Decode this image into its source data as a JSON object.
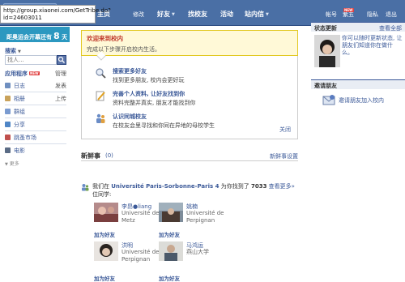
{
  "tooltip": {
    "line1": "http://group.xiaonei.com/GetTribe.do?",
    "line2": "id=24603011"
  },
  "nav": {
    "home": "主页",
    "edit": "修改",
    "friends": "好友",
    "find_friends": "找校友",
    "events": "活动",
    "inbox": "站内信",
    "account": "帐号",
    "homepage": "紫五",
    "new_badge": "NEW",
    "privacy": "隐私",
    "logout": "退出"
  },
  "countdown": {
    "text": "距奥运会开幕还有",
    "days": "8",
    "unit": "天"
  },
  "sidebar": {
    "search_title": "搜索",
    "search_placeholder": "找人...",
    "apps_title": "应用程序",
    "apps_new": "NEW",
    "apps_manage": "管理",
    "items": [
      {
        "label": "日志",
        "action": "发表",
        "color": "#6f8fc0"
      },
      {
        "label": "相册",
        "action": "上传",
        "color": "#c9a25a"
      },
      {
        "label": "群组",
        "action": "",
        "color": "#7a9bd0"
      },
      {
        "label": "分享",
        "action": "",
        "color": "#4f86c6"
      },
      {
        "label": "跳蚤市场",
        "action": "",
        "color": "#c0504d"
      },
      {
        "label": "电影",
        "action": "",
        "color": "#5a6b85"
      }
    ],
    "more": "更多"
  },
  "welcome": {
    "title": "欢迎来到校内",
    "subtitle": "完成以下步骤开启校内生活。"
  },
  "tips": [
    {
      "title": "搜索更多好友",
      "desc": "找到更多朋友, 校内会更好玩"
    },
    {
      "title": "完善个人资料, 让好友找到你",
      "desc": "资料完整并真实, 朋友才能找到你"
    },
    {
      "title": "认识同城校友",
      "desc": "在校友会里寻找和你同在异地的母校学生"
    }
  ],
  "tips_close": "关闭",
  "feed": {
    "title": "新鲜事",
    "count": "(0)",
    "settings": "新鲜事设置"
  },
  "story": {
    "prefix": "我们在",
    "university": "Université Paris-Sorbonne-Paris 4",
    "middle": "为你找到了",
    "count": "7033",
    "more": "查看更多»",
    "suffix": "位同学:"
  },
  "people": [
    {
      "name": "李昂●liang",
      "school": "Université de Metz",
      "add": "加为好友"
    },
    {
      "name": "姚楠",
      "school": "Université de Perpignan",
      "add": "加为好友"
    },
    {
      "name": "洪明",
      "school": "Université de Perpignan",
      "add": "加为好友"
    },
    {
      "name": "马鸿运",
      "school": "燕山大学",
      "add": "加为好友"
    }
  ],
  "status": {
    "title": "状态更新",
    "view_all": "查看全部",
    "message": "你可以随时更新状态, 让朋友们知道你在做什么。"
  },
  "invite": {
    "title": "邀请朋友",
    "label": "邀请朋友加入校内"
  }
}
